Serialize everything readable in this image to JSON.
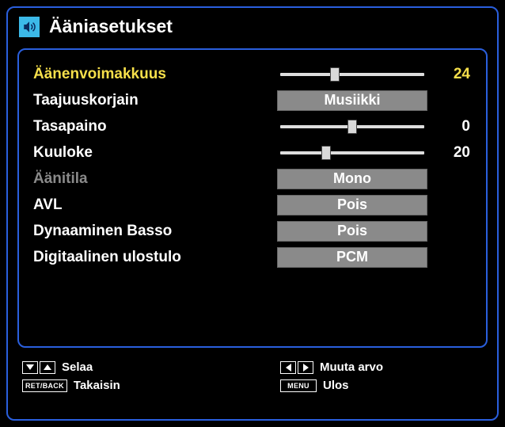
{
  "header": {
    "title": "Ääniasetukset",
    "icon": "sound-settings-icon"
  },
  "rows": [
    {
      "label": "Äänenvoimakkuus",
      "type": "slider",
      "value": 24,
      "min": 0,
      "max": 63,
      "selected": true
    },
    {
      "label": "Taajuuskorjain",
      "type": "select",
      "value": "Musiikki"
    },
    {
      "label": "Tasapaino",
      "type": "slider",
      "value": 0,
      "min": -31,
      "max": 31
    },
    {
      "label": "Kuuloke",
      "type": "slider",
      "value": 20,
      "min": 0,
      "max": 63
    },
    {
      "label": "Äänitila",
      "type": "select",
      "value": "Mono",
      "dim": true
    },
    {
      "label": "AVL",
      "type": "select",
      "value": "Pois"
    },
    {
      "label": "Dynaaminen Basso",
      "type": "select",
      "value": "Pois"
    },
    {
      "label": "Digitaalinen ulostulo",
      "type": "select",
      "value": "PCM"
    }
  ],
  "footer": {
    "col1": [
      {
        "keys": [
          "down",
          "up"
        ],
        "label": "Selaa"
      },
      {
        "keys": [
          "retback"
        ],
        "label": "Takaisin"
      }
    ],
    "col2": [
      {
        "keys": [
          "left",
          "right"
        ],
        "label": "Muuta arvo"
      },
      {
        "keys": [
          "menu"
        ],
        "label": "Ulos"
      }
    ]
  }
}
